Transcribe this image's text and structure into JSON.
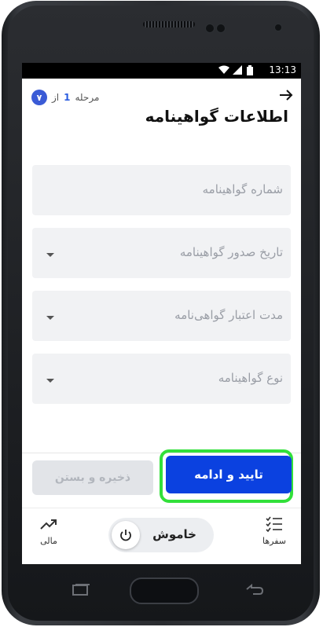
{
  "status_bar": {
    "time": "13:13"
  },
  "header": {
    "back_icon": "arrow-right-icon",
    "step_prefix": "مرحله",
    "step_current": "1",
    "step_separator": "از",
    "step_total": "۷",
    "title": "اطلاعات گواهینامه"
  },
  "form": {
    "fields": [
      {
        "label": "شماره گواهینامه",
        "has_dropdown": false
      },
      {
        "label": "تاریخ صدور گواهینامه",
        "has_dropdown": true
      },
      {
        "label": "مدت اعتبار گواهی‌نامه",
        "has_dropdown": true
      },
      {
        "label": "نوع گواهینامه",
        "has_dropdown": true
      }
    ]
  },
  "actions": {
    "save_close": "ذخیره و بستن",
    "confirm_continue": "تایید و ادامه"
  },
  "bottom_nav": {
    "trips": "سفرها",
    "status_toggle": "خاموش",
    "finance": "مالی"
  },
  "colors": {
    "primary": "#0b41e0",
    "highlight": "#32e03a",
    "field_bg": "#f1f2f4",
    "step_badge": "#3a5bd6"
  }
}
